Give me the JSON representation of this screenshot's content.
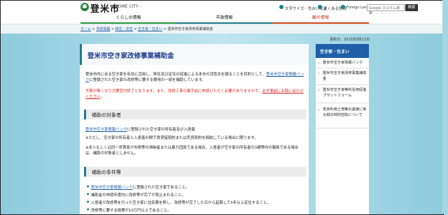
{
  "header": {
    "site_name": "登米市",
    "site_sub": "- TOME CITY -",
    "links": [
      "文字サイズ・色合い変更",
      "よくある質問",
      "Foreign Language"
    ],
    "search_placeholder": "Google カスタム検索",
    "search_button": "検索"
  },
  "nav": {
    "items": [
      "くらしの情報",
      "市政情報",
      "観光情報"
    ],
    "colors": [
      "#2a9a3f",
      "#1b7d8c",
      "#d24a1e"
    ]
  },
  "breadcrumb": [
    "ホーム",
    "市政情報",
    "移住・定住",
    "空き家・住まい",
    "登米市空き家改修事業補助金"
  ],
  "updated": "更新日：2023年9月12日",
  "main": {
    "title": "登米市空き家改修事業補助金",
    "intro_1": "登米市内にある空き家を有効に活用し、移住及び定住の促進による本市の活性化を図ることを目的として、",
    "intro_link": "登米市空き家情報バンク",
    "intro_2": "に登録された空き家の改修等に要する費用の一部を補助しています。",
    "warn_1": "予算が無くなり次第受付終了となります。また、改修工事の着手前に申請いただく必要がありますので、",
    "warn_link": "必ず事前にお問い合わせください",
    "warn_2": "。",
    "section1": "補助の対象者",
    "s1_link": "登米市空き家情報バンク",
    "s1_text": "に登録された空き家の所有者及び入居者",
    "s1_note1": "※ただし、空き家の所有者と入居者の間で賃貸借契約または売買契約を締結している場合に限ります。",
    "s1_note2": "※本人もしくは同一世帯員が市税等の滞納者または暴力団員である場合、入居者が空き家の所有者の3親等内の親族である場合は、補助の対象者としません。",
    "section2": "補助の条件等",
    "b1_link": "登米市空き家情報バンク",
    "b1_text": "に登録された空き家であること。",
    "b2": "補助金の申請年度内に改修等が完了が見込まれること。",
    "b3": "入居者が改修等を行った空き家に住民票を移し、改修等が完了した日から起算して5年以上定住すること。",
    "b4": "改修等に要する経費が10万円以上であること。"
  },
  "sidebar": {
    "heading": "空き家・住まい",
    "items": [
      "登米市空き家情報バンク",
      "登米市空き家改修事業補助金",
      "登米市空き家等利活用促進プラットフォーム",
      "低未利用土地等の譲渡に係る税の特別控除について"
    ]
  }
}
